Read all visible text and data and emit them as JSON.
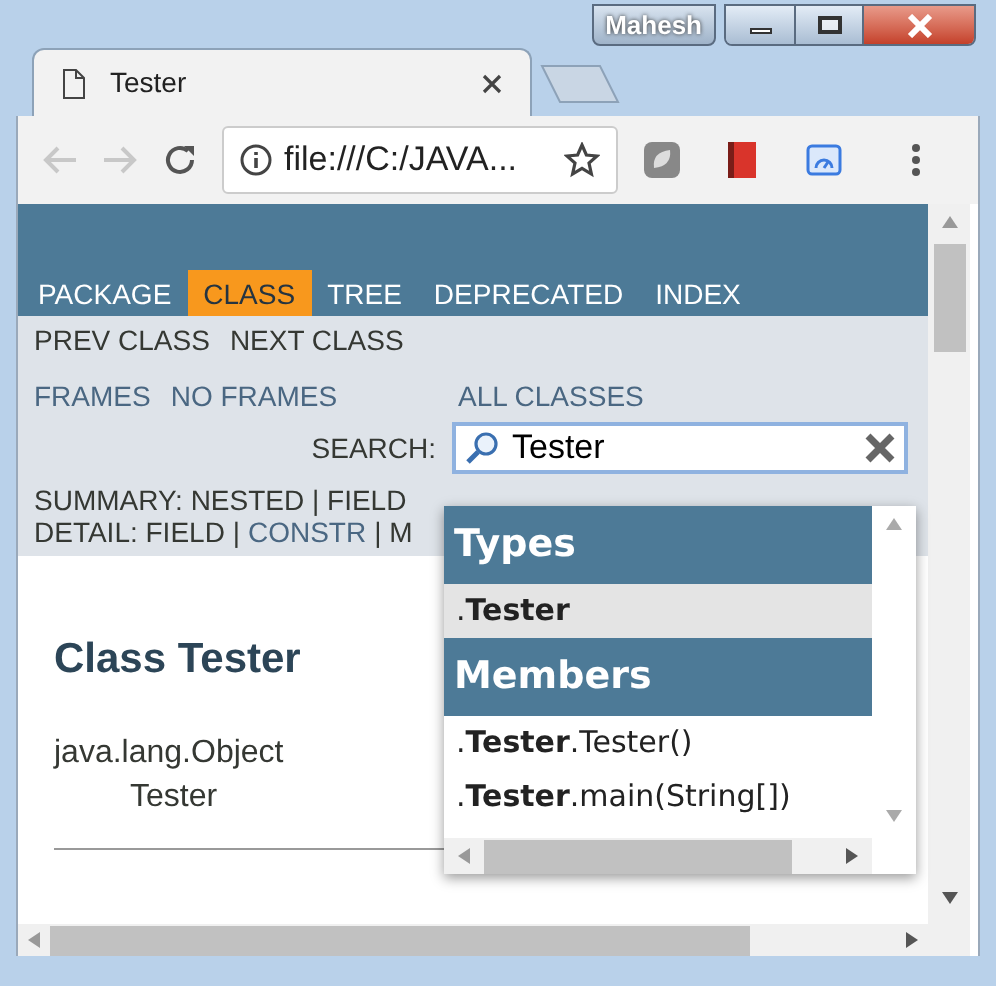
{
  "window": {
    "user": "Mahesh"
  },
  "tabs": [
    {
      "title": "Tester",
      "selected": true
    }
  ],
  "address_bar": {
    "url": "file:///C:/JAVA..."
  },
  "nav": [
    {
      "label": "PACKAGE",
      "selected": false
    },
    {
      "label": "CLASS",
      "selected": true
    },
    {
      "label": "TREE",
      "selected": false
    },
    {
      "label": "DEPRECATED",
      "selected": false
    },
    {
      "label": "INDEX",
      "selected": false
    }
  ],
  "subnav": {
    "prev_next": [
      "PREV CLASS",
      "NEXT CLASS"
    ],
    "frames": [
      "FRAMES",
      "NO FRAMES"
    ],
    "all_classes": "ALL CLASSES",
    "search_label": "SEARCH:",
    "search_value": "Tester",
    "summary": [
      {
        "text": "SUMMARY: NESTED | FIELD",
        "link": false
      }
    ],
    "detail": [
      {
        "text": "DETAIL: FIELD |",
        "link": false
      },
      {
        "text": "CONSTR",
        "link": true
      },
      {
        "text": "| M",
        "link": false
      }
    ]
  },
  "search_results": [
    {
      "heading": "Types",
      "items": [
        {
          "text": ".**Tester**",
          "selected": true
        }
      ]
    },
    {
      "heading": "Members",
      "items": [
        {
          "text": ".**Tester**.Tester()",
          "selected": false
        },
        {
          "text": ".**Tester**.main(String[])",
          "selected": false
        }
      ]
    }
  ],
  "content": {
    "title": "Class Tester",
    "hierarchy": [
      "java.lang.Object",
      "Tester"
    ]
  }
}
